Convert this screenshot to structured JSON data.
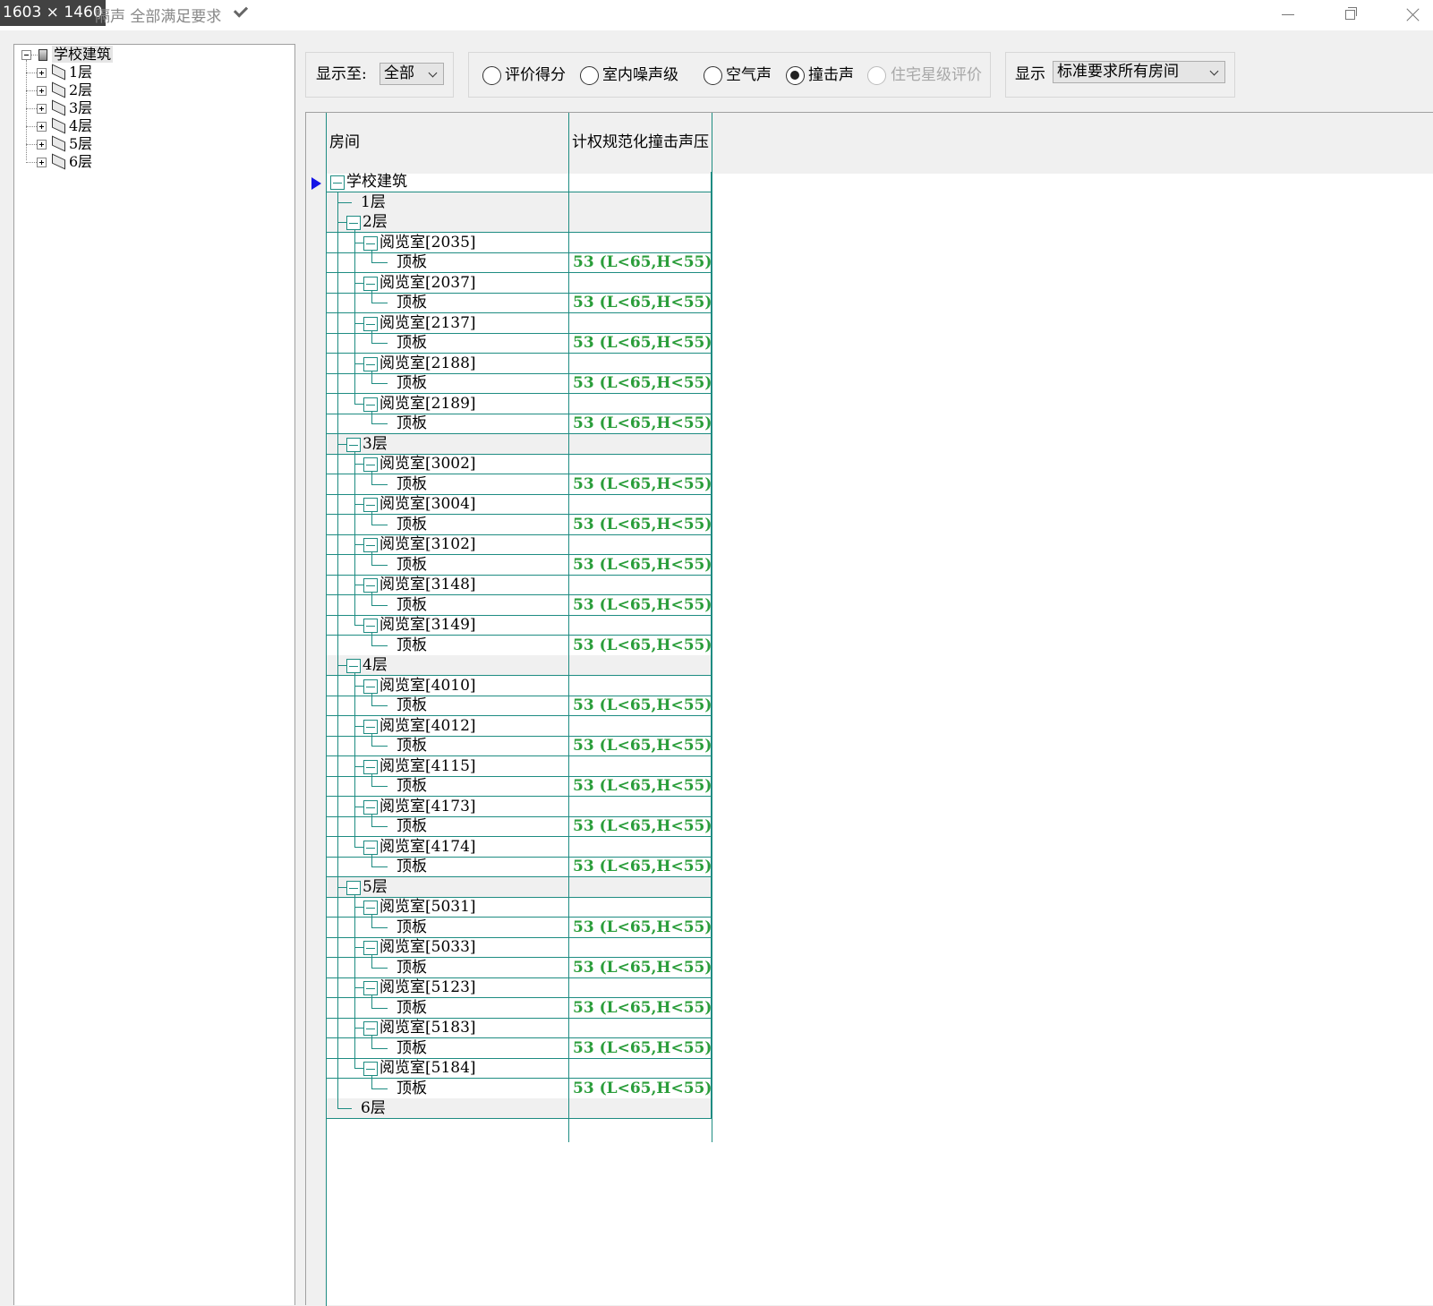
{
  "titlebar": {
    "badge": "1603 × 1460",
    "title": "隔声  全部满足要求",
    "check_icon": "check-icon",
    "buttons": [
      "minimize-icon",
      "restore-icon",
      "close-icon"
    ]
  },
  "tree": {
    "root": "学校建筑",
    "floors": [
      "1层",
      "2层",
      "3层",
      "4层",
      "5层",
      "6层"
    ]
  },
  "toolbar": {
    "show_to_label": "显示至:",
    "show_to_value": "全部",
    "radios": [
      {
        "label": "评价得分",
        "checked": false,
        "disabled": false
      },
      {
        "label": "室内噪声级",
        "checked": false,
        "disabled": false
      },
      {
        "label": "空气声",
        "checked": false,
        "disabled": false
      },
      {
        "label": "撞击声",
        "checked": true,
        "disabled": false
      },
      {
        "label": "住宅星级评价",
        "checked": false,
        "disabled": true
      }
    ],
    "display_label": "显示",
    "display_value": "标准要求所有房间"
  },
  "grid": {
    "columns": [
      "房间",
      "计权规范化撞击声压"
    ],
    "root_label": "学校建筑",
    "value_text": "53 (L<65,H<55)",
    "rows": [
      {
        "type": "root",
        "label": "学校建筑"
      },
      {
        "type": "floor-leaf",
        "label": "1层"
      },
      {
        "type": "floor",
        "label": "2层"
      },
      {
        "type": "room",
        "label": "阅览室[2035]"
      },
      {
        "type": "element",
        "label": "顶板",
        "value": "53 (L<65,H<55)"
      },
      {
        "type": "room",
        "label": "阅览室[2037]"
      },
      {
        "type": "element",
        "label": "顶板",
        "value": "53 (L<65,H<55)"
      },
      {
        "type": "room",
        "label": "阅览室[2137]"
      },
      {
        "type": "element",
        "label": "顶板",
        "value": "53 (L<65,H<55)"
      },
      {
        "type": "room",
        "label": "阅览室[2188]"
      },
      {
        "type": "element",
        "label": "顶板",
        "value": "53 (L<65,H<55)"
      },
      {
        "type": "room",
        "label": "阅览室[2189]",
        "last": true
      },
      {
        "type": "element",
        "label": "顶板",
        "value": "53 (L<65,H<55)"
      },
      {
        "type": "floor",
        "label": "3层"
      },
      {
        "type": "room",
        "label": "阅览室[3002]"
      },
      {
        "type": "element",
        "label": "顶板",
        "value": "53 (L<65,H<55)"
      },
      {
        "type": "room",
        "label": "阅览室[3004]"
      },
      {
        "type": "element",
        "label": "顶板",
        "value": "53 (L<65,H<55)"
      },
      {
        "type": "room",
        "label": "阅览室[3102]"
      },
      {
        "type": "element",
        "label": "顶板",
        "value": "53 (L<65,H<55)"
      },
      {
        "type": "room",
        "label": "阅览室[3148]"
      },
      {
        "type": "element",
        "label": "顶板",
        "value": "53 (L<65,H<55)"
      },
      {
        "type": "room",
        "label": "阅览室[3149]",
        "last": true
      },
      {
        "type": "element",
        "label": "顶板",
        "value": "53 (L<65,H<55)"
      },
      {
        "type": "floor",
        "label": "4层"
      },
      {
        "type": "room",
        "label": "阅览室[4010]"
      },
      {
        "type": "element",
        "label": "顶板",
        "value": "53 (L<65,H<55)"
      },
      {
        "type": "room",
        "label": "阅览室[4012]"
      },
      {
        "type": "element",
        "label": "顶板",
        "value": "53 (L<65,H<55)"
      },
      {
        "type": "room",
        "label": "阅览室[4115]"
      },
      {
        "type": "element",
        "label": "顶板",
        "value": "53 (L<65,H<55)"
      },
      {
        "type": "room",
        "label": "阅览室[4173]"
      },
      {
        "type": "element",
        "label": "顶板",
        "value": "53 (L<65,H<55)"
      },
      {
        "type": "room",
        "label": "阅览室[4174]",
        "last": true
      },
      {
        "type": "element",
        "label": "顶板",
        "value": "53 (L<65,H<55)"
      },
      {
        "type": "floor",
        "label": "5层"
      },
      {
        "type": "room",
        "label": "阅览室[5031]"
      },
      {
        "type": "element",
        "label": "顶板",
        "value": "53 (L<65,H<55)"
      },
      {
        "type": "room",
        "label": "阅览室[5033]"
      },
      {
        "type": "element",
        "label": "顶板",
        "value": "53 (L<65,H<55)"
      },
      {
        "type": "room",
        "label": "阅览室[5123]"
      },
      {
        "type": "element",
        "label": "顶板",
        "value": "53 (L<65,H<55)"
      },
      {
        "type": "room",
        "label": "阅览室[5183]"
      },
      {
        "type": "element",
        "label": "顶板",
        "value": "53 (L<65,H<55)"
      },
      {
        "type": "room",
        "label": "阅览室[5184]",
        "last": true
      },
      {
        "type": "element",
        "label": "顶板",
        "value": "53 (L<65,H<55)"
      },
      {
        "type": "floor-leaf",
        "label": "6层",
        "last": true
      }
    ]
  },
  "colors": {
    "grid_line": "#1e8c82",
    "value_text": "#2a9d3a",
    "current_row_arrow": "#1414e6"
  }
}
